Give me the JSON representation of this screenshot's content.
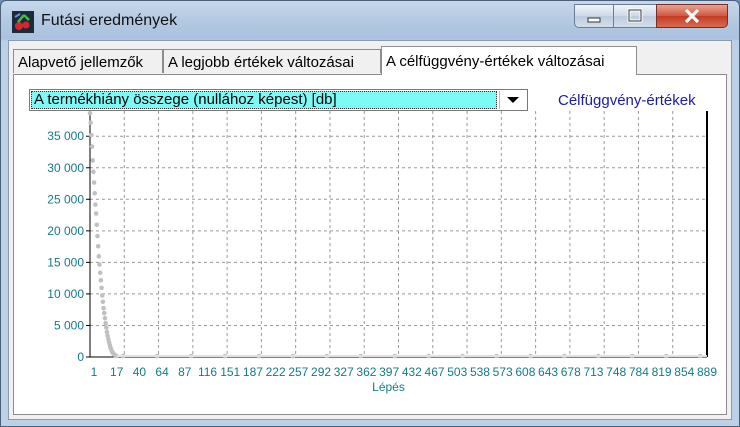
{
  "window": {
    "title": "Futási eredmények"
  },
  "tabs": [
    {
      "label": "Alapvető jellemzők",
      "active": false
    },
    {
      "label": "A legjobb értékek változásai",
      "active": false
    },
    {
      "label": "A célfüggvény-értékek változásai",
      "active": true
    }
  ],
  "selector": {
    "value": "A termékhiány összege (nullához képest) [db]"
  },
  "chart_legend": "Célfüggvény-értékek",
  "colors": {
    "points": "#c0c0c0",
    "legend": "#1a1ab0",
    "ticks": "#157a8a",
    "dropdown": "#7dfaf6"
  },
  "chart_data": {
    "type": "scatter",
    "xlabel": "Lépés",
    "ylabel": "",
    "ylim": [
      0,
      39000
    ],
    "xlim": [
      1,
      910
    ],
    "grid": true,
    "y_ticks": [
      0,
      5000,
      10000,
      15000,
      20000,
      25000,
      30000,
      35000
    ],
    "y_tick_labels": [
      "0",
      "5 000",
      "10 000",
      "15 000",
      "20 000",
      "25 000",
      "30 000",
      "35 000"
    ],
    "x_tick_labels": [
      "1",
      "17",
      "40",
      "64",
      "87",
      "116",
      "151",
      "187",
      "222",
      "257",
      "292",
      "327",
      "362",
      "397",
      "432",
      "467",
      "503",
      "538",
      "573",
      "608",
      "643",
      "678",
      "713",
      "748",
      "784",
      "819",
      "854",
      "889"
    ],
    "series": [
      {
        "points": [
          [
            1,
            38500
          ],
          [
            2,
            37000
          ],
          [
            3,
            35000
          ],
          [
            4,
            33200
          ],
          [
            5,
            31000
          ],
          [
            6,
            29200
          ],
          [
            7,
            27500
          ],
          [
            8,
            25800
          ],
          [
            9,
            24000
          ],
          [
            10,
            22600
          ],
          [
            11,
            20800
          ],
          [
            12,
            19000
          ],
          [
            13,
            17400
          ],
          [
            14,
            15800
          ],
          [
            15,
            14500
          ],
          [
            16,
            13200
          ],
          [
            17,
            12000
          ],
          [
            18,
            10800
          ],
          [
            19,
            9600
          ],
          [
            20,
            8600
          ],
          [
            21,
            7600
          ],
          [
            22,
            6800
          ],
          [
            23,
            6000
          ],
          [
            24,
            5200
          ],
          [
            25,
            4500
          ],
          [
            26,
            3800
          ],
          [
            27,
            3200
          ],
          [
            28,
            2700
          ],
          [
            29,
            2200
          ],
          [
            30,
            1800
          ],
          [
            31,
            1400
          ],
          [
            32,
            1100
          ],
          [
            33,
            800
          ],
          [
            34,
            600
          ],
          [
            35,
            450
          ],
          [
            36,
            300
          ],
          [
            37,
            200
          ],
          [
            38,
            120
          ],
          [
            39,
            60
          ],
          [
            40,
            20
          ],
          [
            50,
            0
          ],
          [
            100,
            0
          ],
          [
            150,
            0
          ],
          [
            200,
            0
          ],
          [
            250,
            0
          ],
          [
            300,
            0
          ],
          [
            350,
            0
          ],
          [
            400,
            0
          ],
          [
            450,
            0
          ],
          [
            500,
            0
          ],
          [
            550,
            0
          ],
          [
            600,
            0
          ],
          [
            650,
            0
          ],
          [
            700,
            0
          ],
          [
            750,
            0
          ],
          [
            800,
            0
          ],
          [
            850,
            0
          ],
          [
            900,
            0
          ]
        ]
      }
    ]
  }
}
